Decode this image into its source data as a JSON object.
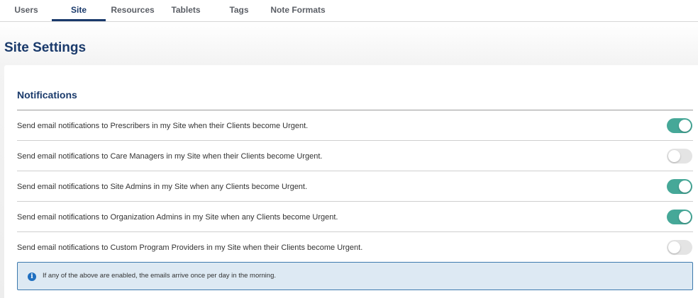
{
  "tabs": [
    {
      "label": "Users",
      "active": false
    },
    {
      "label": "Site",
      "active": true
    },
    {
      "label": "Resources",
      "active": false
    },
    {
      "label": "Tablets",
      "active": false
    },
    {
      "label": "Tags",
      "active": false
    },
    {
      "label": "Note Formats",
      "active": false
    }
  ],
  "page": {
    "title": "Site Settings"
  },
  "notifications": {
    "title": "Notifications",
    "rows": [
      {
        "label": "Send email notifications to Prescribers in my Site when their Clients become Urgent.",
        "enabled": true
      },
      {
        "label": "Send email notifications to Care Managers in my Site when their Clients become Urgent.",
        "enabled": false
      },
      {
        "label": "Send email notifications to Site Admins in my Site when any Clients become Urgent.",
        "enabled": true
      },
      {
        "label": "Send email notifications to Organization Admins in my Site when any Clients become Urgent.",
        "enabled": true
      },
      {
        "label": "Send email notifications to Custom Program Providers in my Site when their Clients become Urgent.",
        "enabled": false
      }
    ],
    "info": {
      "icon": "info-icon",
      "text": "If any of the above are enabled, the emails arrive once per day in the morning."
    }
  },
  "colors": {
    "accent": "#1a3a6b",
    "toggle_on": "#46a898",
    "toggle_off": "#e4e4e4",
    "info_bg": "#dde9f3",
    "info_border": "#3d79ad"
  }
}
